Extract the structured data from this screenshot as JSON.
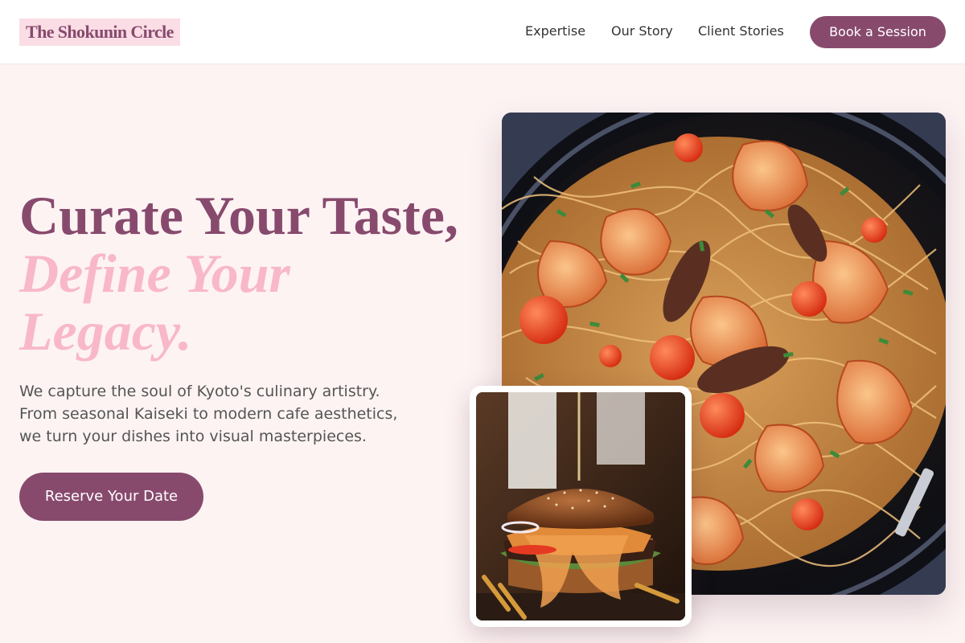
{
  "header": {
    "logo": "The Shokunin Circle",
    "nav": [
      "Expertise",
      "Our Story",
      "Client Stories"
    ],
    "cta": "Book a Session"
  },
  "hero": {
    "headline_line1": "Curate Your Taste,",
    "headline_line2": "Define Your",
    "headline_line3": "Legacy.",
    "description_lines": [
      "We capture the soul of Kyoto's culinary artistry.",
      "From seasonal Kaiseki to modern cafe aesthetics,",
      "we turn your dishes into visual masterpieces."
    ],
    "cta": "Reserve Your Date"
  },
  "images": {
    "main": {
      "icon": "shrimp-pasta-photo"
    },
    "inset": {
      "icon": "burger-photo"
    }
  },
  "colors": {
    "brand": "#874a6d",
    "accent_pink": "#f8b8c9",
    "background": "#fdf3f3"
  }
}
